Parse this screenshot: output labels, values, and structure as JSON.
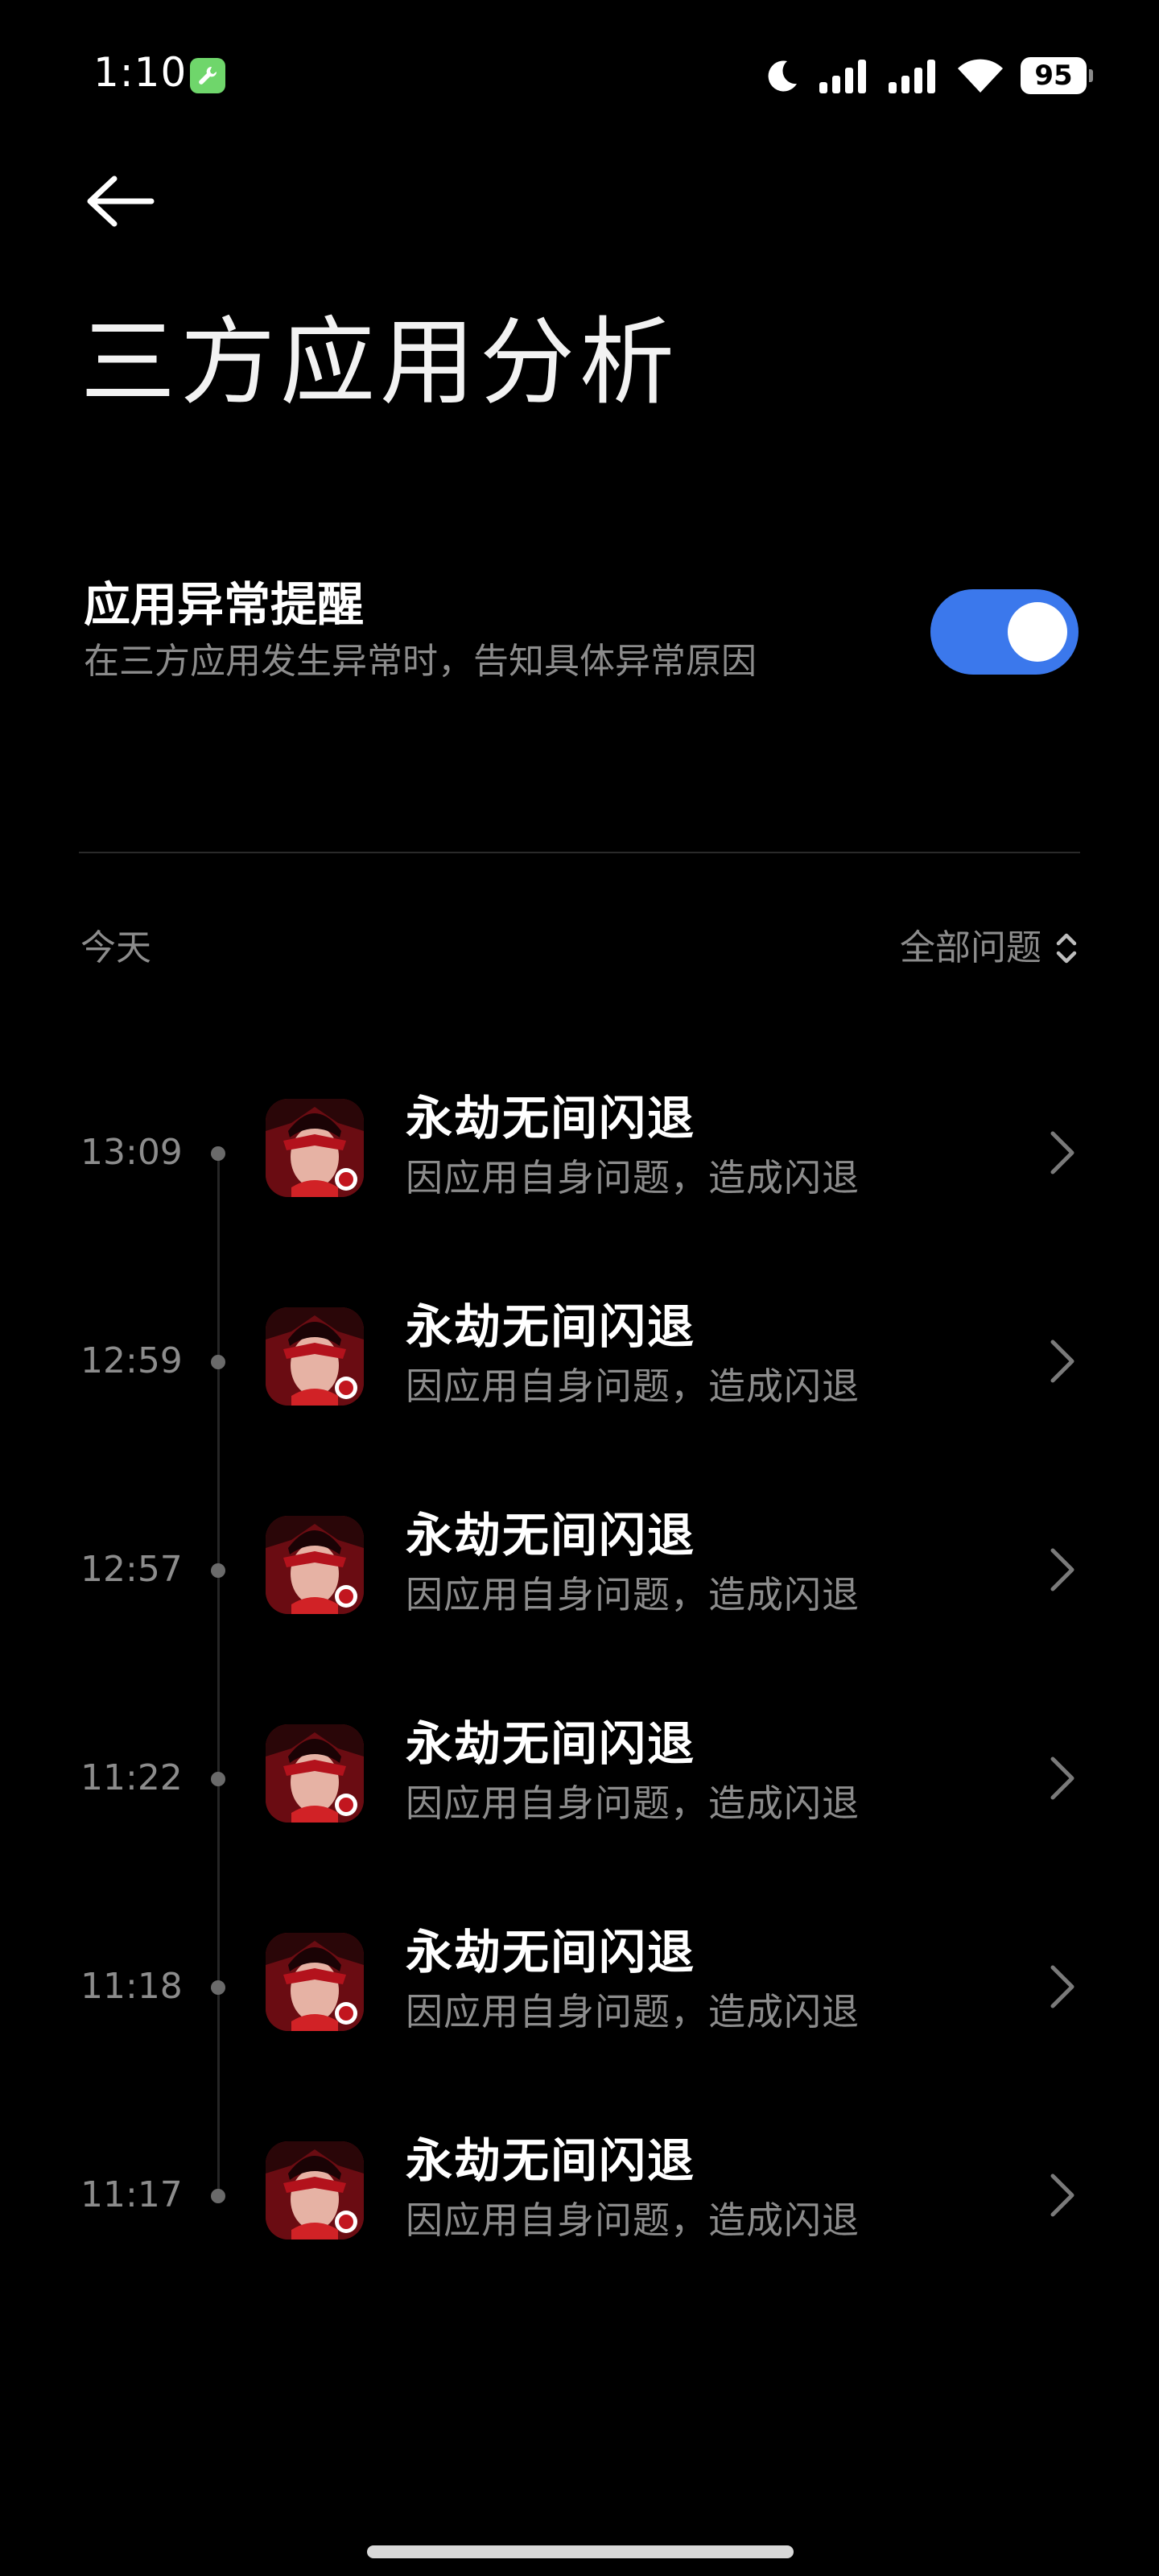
{
  "status_bar": {
    "time": "1:10",
    "app_icon": "wrench-icon",
    "icons": [
      "moon-icon",
      "signal-icon",
      "signal-icon",
      "wifi-icon"
    ],
    "battery": "95"
  },
  "header": {
    "back_icon": "back-arrow-icon",
    "title": "三方应用分析"
  },
  "setting": {
    "title": "应用异常提醒",
    "subtitle": "在三方应用发生异常时，告知具体异常原因",
    "toggle_on": true,
    "toggle_color": "#3b78ec"
  },
  "list_header": {
    "section_label": "今天",
    "filter_label": "全部问题",
    "filter_icon": "sort-updown-icon"
  },
  "events": [
    {
      "time": "13:09",
      "title": "永劫无间闪退",
      "desc": "因应用自身问题，造成闪退"
    },
    {
      "time": "12:59",
      "title": "永劫无间闪退",
      "desc": "因应用自身问题，造成闪退"
    },
    {
      "time": "12:57",
      "title": "永劫无间闪退",
      "desc": "因应用自身问题，造成闪退"
    },
    {
      "time": "11:22",
      "title": "永劫无间闪退",
      "desc": "因应用自身问题，造成闪退"
    },
    {
      "time": "11:18",
      "title": "永劫无间闪退",
      "desc": "因应用自身问题，造成闪退"
    },
    {
      "time": "11:17",
      "title": "永劫无间闪退",
      "desc": "因应用自身问题，造成闪退"
    }
  ]
}
